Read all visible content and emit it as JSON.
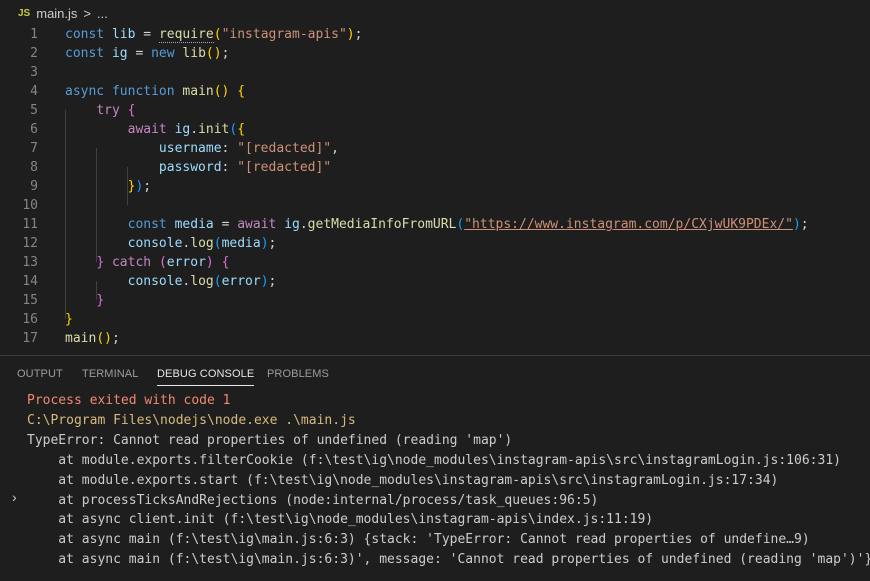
{
  "breadcrumb": {
    "badge": "JS",
    "file": "main.js",
    "sep": ">",
    "more": "..."
  },
  "code_lines": [
    {
      "n": "1"
    },
    {
      "n": "2"
    },
    {
      "n": "3"
    },
    {
      "n": "4"
    },
    {
      "n": "5"
    },
    {
      "n": "6"
    },
    {
      "n": "7"
    },
    {
      "n": "8"
    },
    {
      "n": "9"
    },
    {
      "n": "10"
    },
    {
      "n": "11"
    },
    {
      "n": "12"
    },
    {
      "n": "13"
    },
    {
      "n": "14"
    },
    {
      "n": "15"
    },
    {
      "n": "16"
    },
    {
      "n": "17"
    }
  ],
  "code": {
    "l1": {
      "k": "const",
      "v": "lib",
      "eq": "=",
      "f": "require",
      "s": "\"instagram-apis\"",
      "end": ";"
    },
    "l2": {
      "k": "const",
      "v": "ig",
      "eq": "=",
      "n": "new",
      "f": "lib",
      "end": ";"
    },
    "l4": {
      "k": "async",
      "k2": "function",
      "f": "main"
    },
    "l5": {
      "k": "try"
    },
    "l6": {
      "k": "await",
      "v": "ig",
      "f": "init"
    },
    "l7": {
      "v": "username",
      "s": "\"[redacted]\"",
      "end": ","
    },
    "l8": {
      "v": "password",
      "s": "\"[redacted]\""
    },
    "l11": {
      "k": "const",
      "v": "media",
      "eq": "=",
      "k2": "await",
      "v2": "ig",
      "f": "getMediaInfoFromURL",
      "s": "\"https://www.instagram.com/p/CXjwUK9PDEx/\"",
      "end": ";"
    },
    "l12": {
      "v": "console",
      "f": "log",
      "a": "media",
      "end": ";"
    },
    "l13": {
      "k": "catch",
      "a": "error"
    },
    "l14": {
      "v": "console",
      "f": "log",
      "a": "error",
      "end": ";"
    },
    "l17": {
      "f": "main",
      "end": ";"
    }
  },
  "panel": {
    "tabs": [
      "OUTPUT",
      "TERMINAL",
      "DEBUG CONSOLE",
      "PROBLEMS"
    ],
    "active_tab": "DEBUG CONSOLE",
    "console": [
      "Process exited with code 1",
      "C:\\Program Files\\nodejs\\node.exe .\\main.js",
      "TypeError: Cannot read properties of undefined (reading 'map')",
      "    at module.exports.filterCookie (f:\\test\\ig\\node_modules\\instagram-apis\\src\\instagramLogin.js:106:31)",
      "    at module.exports.start (f:\\test\\ig\\node_modules\\instagram-apis\\src\\instagramLogin.js:17:34)",
      "    at processTicksAndRejections (node:internal/process/task_queues:96:5)",
      "    at async client.init (f:\\test\\ig\\node_modules\\instagram-apis\\index.js:11:19)",
      "    at async main (f:\\test\\ig\\main.js:6:3) {stack: 'TypeError: Cannot read properties of undefine…9)",
      "    at async main (f:\\test\\ig\\main.js:6:3)', message: 'Cannot read properties of undefined (reading 'map')'}"
    ],
    "colors": {
      "error": "#f48771",
      "path": "#d7ba7d",
      "normal": "#cccccc"
    },
    "expand_icon": "chevron-right-icon"
  }
}
